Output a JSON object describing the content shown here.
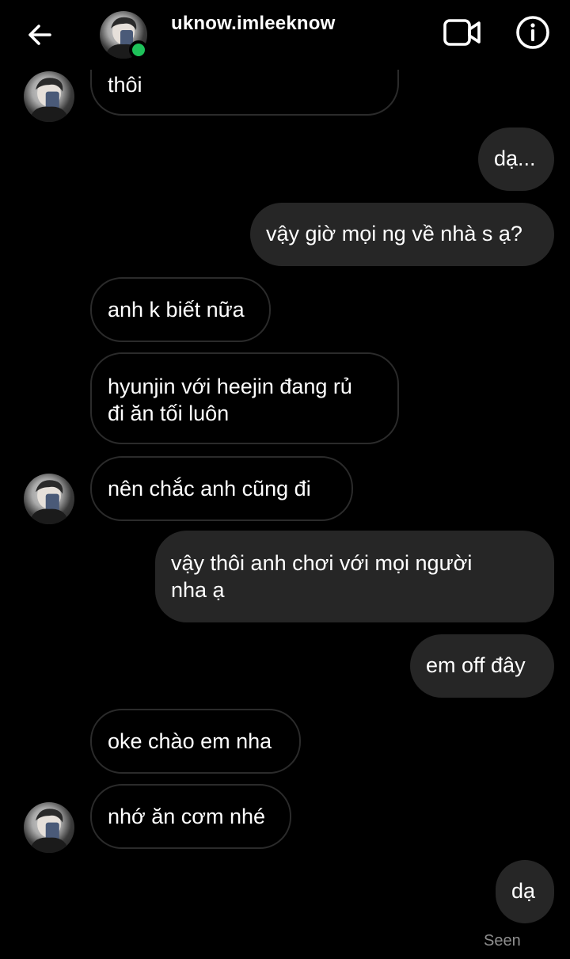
{
  "header": {
    "username": "uknow.imleeknow",
    "back_icon": "arrow-left-icon",
    "video_icon": "video-camera-icon",
    "info_icon": "info-icon",
    "online_color": "#1ec25a"
  },
  "messages": [
    {
      "direction": "in",
      "text": "thôi"
    },
    {
      "direction": "out",
      "text": "dạ..."
    },
    {
      "direction": "out",
      "text": "vậy giờ mọi ng về nhà s ạ?"
    },
    {
      "direction": "in",
      "text": "anh k biết nữa"
    },
    {
      "direction": "in",
      "line1": "hyunjin với heejin đang rủ",
      "line2": "đi ăn tối luôn"
    },
    {
      "direction": "in",
      "text": "nên chắc anh cũng đi"
    },
    {
      "direction": "out",
      "line1": "vậy thôi anh chơi với mọi người",
      "line2": "nha ạ"
    },
    {
      "direction": "out",
      "text": "em off đây"
    },
    {
      "direction": "in",
      "text": "oke chào em nha"
    },
    {
      "direction": "in",
      "text": "nhớ ăn cơm nhé"
    },
    {
      "direction": "out",
      "text": "dạ"
    }
  ],
  "status": {
    "seen": "Seen"
  },
  "colors": {
    "background": "#000000",
    "outgoing_bubble": "#262626",
    "incoming_border": "#2b2b2b",
    "muted_text": "#8e8e8e"
  }
}
